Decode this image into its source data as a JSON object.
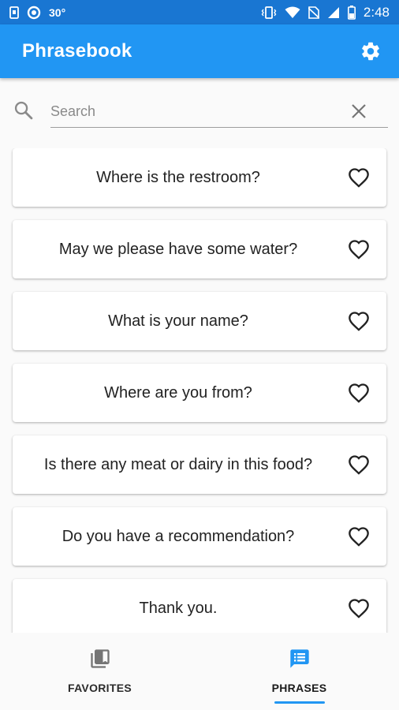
{
  "status_bar": {
    "temperature": "30°",
    "time": "2:48",
    "icons": [
      "sim-icon",
      "circle-notification-icon",
      "vibrate-icon",
      "wifi-icon",
      "no-sim-icon",
      "signal-icon",
      "battery-icon"
    ]
  },
  "app_bar": {
    "title": "Phrasebook",
    "settings_icon": "gear-icon"
  },
  "search": {
    "placeholder": "Search",
    "value": "",
    "search_icon": "search-icon",
    "clear_icon": "close-icon"
  },
  "phrases": [
    {
      "text": "Where is the restroom?",
      "favorited": false
    },
    {
      "text": "May we please have some water?",
      "favorited": false
    },
    {
      "text": "What is your name?",
      "favorited": false
    },
    {
      "text": "Where are you from?",
      "favorited": false
    },
    {
      "text": "Is there any meat or dairy in this food?",
      "favorited": false
    },
    {
      "text": "Do you have a recommendation?",
      "favorited": false
    },
    {
      "text": "Thank you.",
      "favorited": false
    }
  ],
  "bottom_nav": {
    "favorites_label": "FAVORITES",
    "phrases_label": "PHRASES",
    "active_tab": "PHRASES"
  },
  "colors": {
    "primary": "#2196f3",
    "status_bar": "#1976d2",
    "inactive_icon": "#757575"
  }
}
